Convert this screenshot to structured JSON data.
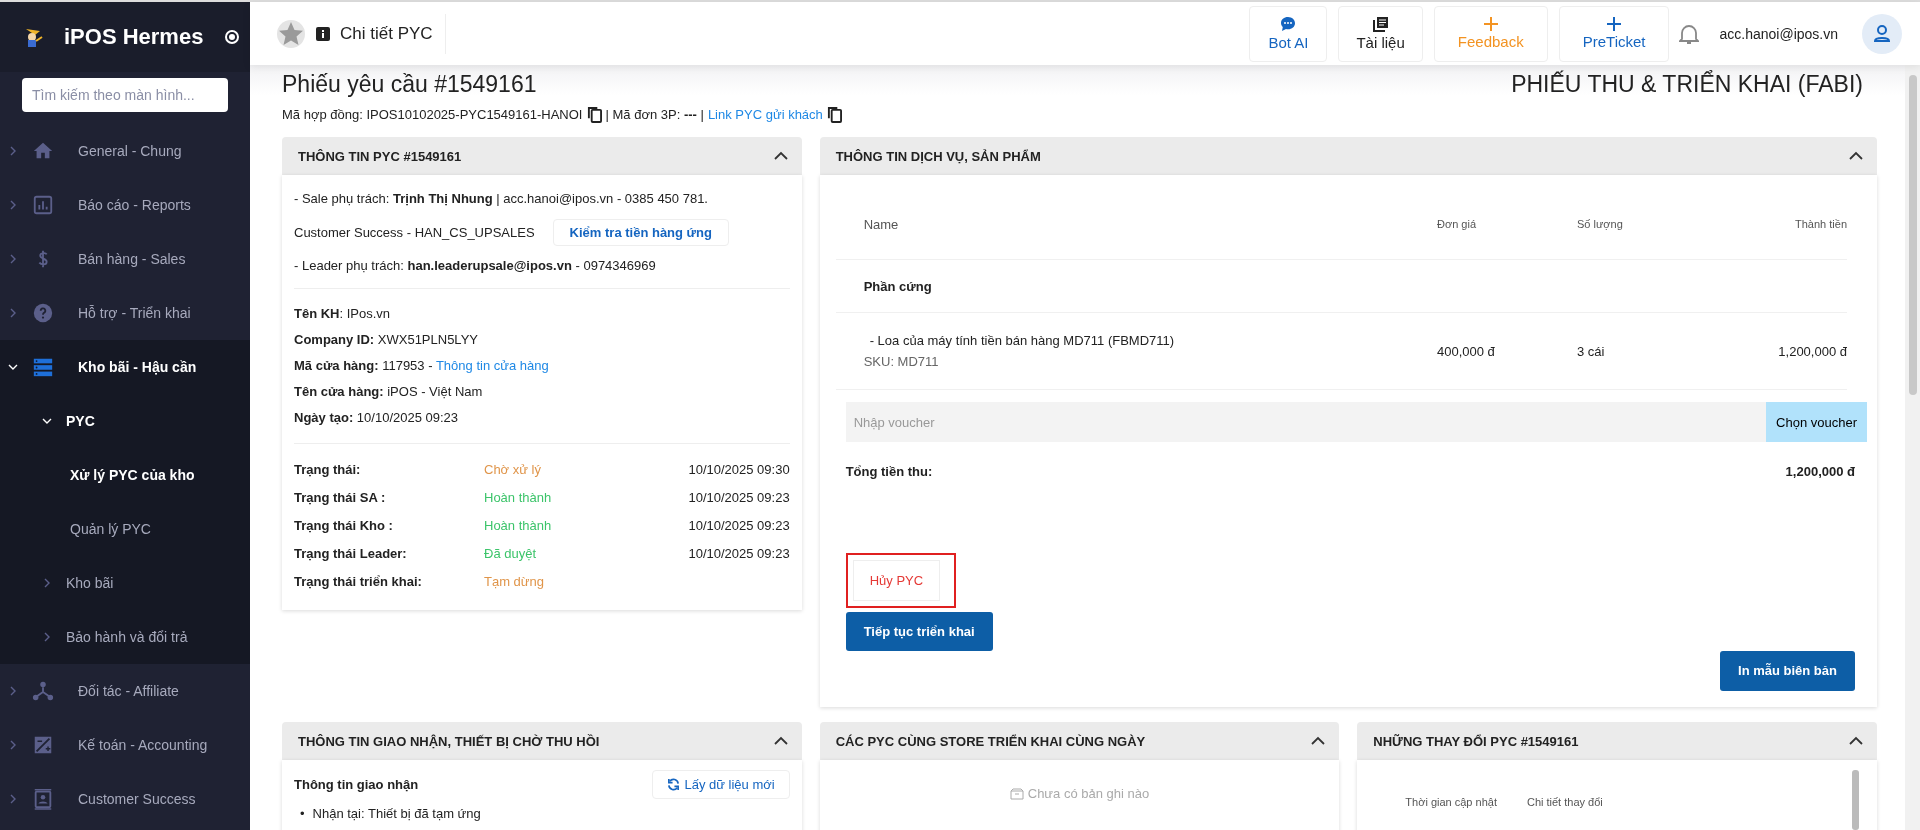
{
  "sidebar": {
    "app_name": "iPOS Hermes",
    "search": {
      "placeholder": "Tìm kiếm theo màn hình..."
    },
    "items": [
      {
        "label": "General - Chung",
        "expanded": false
      },
      {
        "label": "Báo cáo - Reports",
        "expanded": false
      },
      {
        "label": "Bán hàng - Sales",
        "expanded": false
      },
      {
        "label": "Hỗ trợ - Triển khai",
        "expanded": false
      },
      {
        "label": "Kho bãi - Hậu cần",
        "expanded": true,
        "children": [
          {
            "label": "PYC",
            "expanded": true,
            "children": [
              {
                "label": "Xử lý PYC của kho",
                "selected": true
              },
              {
                "label": "Quản lý PYC",
                "selected": false
              }
            ]
          },
          {
            "label": "Kho bãi",
            "expanded": false
          },
          {
            "label": "Bảo hành và đổi trả",
            "expanded": false
          }
        ]
      },
      {
        "label": "Đối tác - Affiliate",
        "expanded": false
      },
      {
        "label": "Kế toán - Accounting",
        "expanded": false
      },
      {
        "label": "Customer Success",
        "expanded": false
      }
    ]
  },
  "header": {
    "title": "Chi tiết PYC",
    "buttons": [
      {
        "label": "Bot AI",
        "kind": "chat",
        "color": "#1565c0"
      },
      {
        "label": "Tài liệu",
        "kind": "book",
        "color": "#222222"
      },
      {
        "label": "Feedback",
        "kind": "plus",
        "color": "#f39322"
      },
      {
        "label": "PreTicket",
        "kind": "plus",
        "color": "#1565c0"
      }
    ],
    "user": "acc.hanoi@ipos.vn"
  },
  "page": {
    "title": "Phiếu yêu cầu #1549161",
    "subtitle": "PHIẾU THU & TRIỂN KHAI (FABI)",
    "contract": "Mã hợp đồng: IPOS10102025-PYC1549161-HANOI",
    "order_3p": "| Mã đơn 3P: **---** |",
    "link": "Link PYC gửi khách"
  },
  "info_card": {
    "title": "THÔNG TIN PYC #1549161",
    "sale": "- Sale phụ trách: **Trịnh Thị Nhung** | acc.hanoi@ipos.vn - 0385 450 781.",
    "cs": "Customer Success - HAN_CS_UPSALES",
    "cs_button": "Kiểm tra tiền hàng ứng",
    "leader": "- Leader phụ trách: **han.leaderupsale@ipos.vn** - 0974346969",
    "fields": [
      {
        "label": "Tên KH",
        "value": ": IPos.vn"
      },
      {
        "label": "Company ID:",
        "value": " XWX51PLN5LYY"
      },
      {
        "label": "Mã cửa hàng:",
        "value": " 117953 - ",
        "link": "Thông tin cửa hàng"
      },
      {
        "label": "Tên cửa hàng:",
        "value": " iPOS - Việt Nam"
      },
      {
        "label": "Ngày tạo:",
        "value": " 10/10/2025 09:23"
      }
    ],
    "statuses": [
      {
        "label": "Trạng thái:",
        "value": "Chờ xử lý",
        "time": "10/10/2025 09:30",
        "color": "#e0954a"
      },
      {
        "label": "Trạng thái SA :",
        "value": "Hoàn thành",
        "time": "10/10/2025 09:23",
        "color": "#3cc46a"
      },
      {
        "label": "Trạng thái Kho :",
        "value": "Hoàn thành",
        "time": "10/10/2025 09:23",
        "color": "#3cc46a"
      },
      {
        "label": "Trạng thái Leader:",
        "value": "Đã duyệt",
        "time": "10/10/2025 09:23",
        "color": "#3cc46a"
      },
      {
        "label": "Trạng thái triển khai:",
        "value": "Tạm dừng",
        "color": "#e0954a"
      }
    ]
  },
  "product_card": {
    "title": "THÔNG TIN DỊCH VỤ, SẢN PHẨM",
    "columns": [
      "Name",
      "Đơn giá",
      "Số lượng",
      "Thành tiền"
    ],
    "group": "Phần cứng",
    "items": [
      {
        "name": "- Loa của máy tính tiền bán hàng MD711 (FBMD711)",
        "sku": "SKU: MD711",
        "price": "400,000 đ",
        "qty": "3 cái",
        "total": "1,200,000 đ"
      }
    ],
    "voucher": {
      "placeholder": "Nhập voucher",
      "button": "Chọn voucher"
    },
    "total_label": "Tổng tiền thu:",
    "total_value": "1,200,000 đ",
    "cancel": {
      "label": "Hủy PYC",
      "highlighted": true
    },
    "continue": "Tiếp tục triển khai",
    "print": "In mẫu biên bản"
  },
  "delivery_card": {
    "title": "THÔNG TIN GIAO NHẬN, THIẾT BỊ CHỜ THU HỒI",
    "heading": "Thông tin giao nhận",
    "refresh": "Lấy dữ liệu mới",
    "bullets": [
      {
        "marker": "•",
        "text": "Nhận tại: Thiết bị đã tạm ứng"
      }
    ]
  },
  "same_day_card": {
    "title": "CÁC PYC CÙNG STORE TRIỂN KHAI CÙNG NGÀY",
    "empty": "Chưa có bản ghi nào"
  },
  "changes_card": {
    "title": "NHỮNG THAY ĐỔI PYC #1549161",
    "columns": [
      "Thời gian cập nhật",
      "Chi tiết thay đổi"
    ]
  }
}
